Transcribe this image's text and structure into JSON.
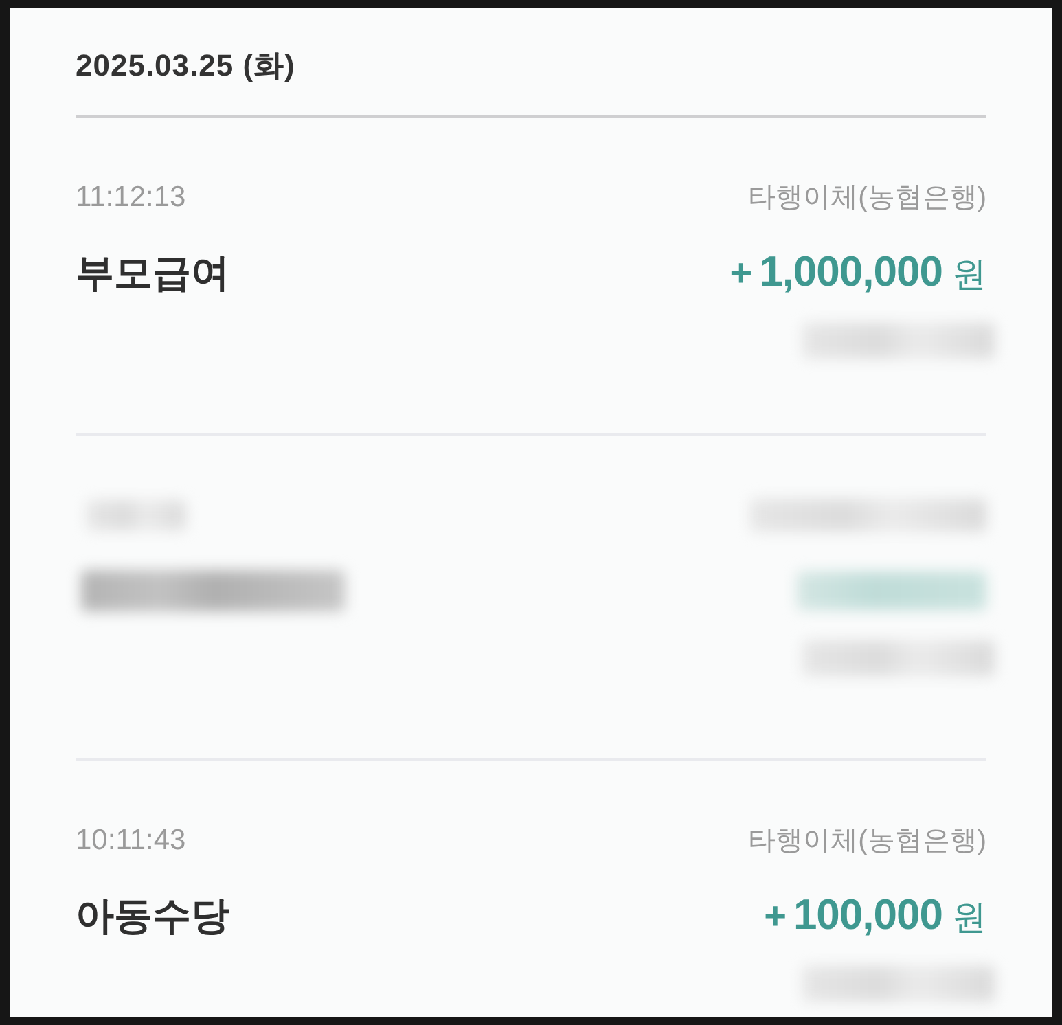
{
  "date_header": {
    "date": "2025.03.25 (화)"
  },
  "transactions": [
    {
      "blurred": false,
      "time": "11:12:13",
      "type": "타행이체(농협은행)",
      "name": "부모급여",
      "sign": "+",
      "amount": "1,000,000",
      "unit": "원",
      "balance_blurred": true
    },
    {
      "blurred": true,
      "balance_blurred": true
    },
    {
      "blurred": false,
      "time": "10:11:43",
      "type": "타행이체(농협은행)",
      "name": "아동수당",
      "sign": "+",
      "amount": "100,000",
      "unit": "원",
      "balance_blurred": true
    }
  ]
}
